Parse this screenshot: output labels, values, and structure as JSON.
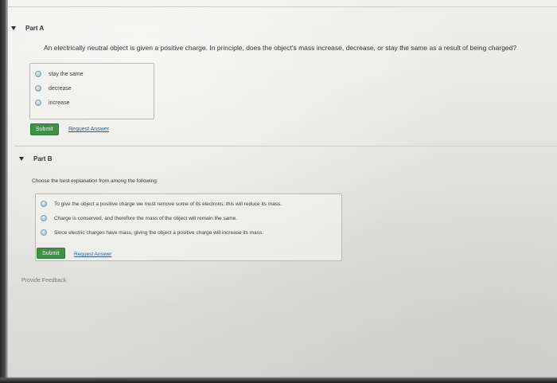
{
  "part_a": {
    "title": "Part A",
    "question": "An electrically neutral object is given a positive charge. In principle, does the object's mass increase, decrease, or stay the same as a result of being charged?",
    "options": [
      "stay the same",
      "decrease",
      "increase"
    ],
    "submit_label": "Submit",
    "request_label": "Request Answer"
  },
  "part_b": {
    "title": "Part B",
    "question": "Choose the best explanation from among the following:",
    "options": [
      "To give the object a positive charge we must remove some of its electrons; this will reduce its mass.",
      "Charge is conserved, and therefore the mass of the object will remain the same.",
      "Since electric charges have mass, giving the object a positive charge will increase its mass."
    ],
    "submit_label": "Submit",
    "request_label": "Request Answer"
  },
  "feedback_label": "Provide Feedback",
  "colors": {
    "submit_green": "#3f9145",
    "link_blue": "#2a5f8f",
    "radio_blue": "#b9cdd8"
  }
}
